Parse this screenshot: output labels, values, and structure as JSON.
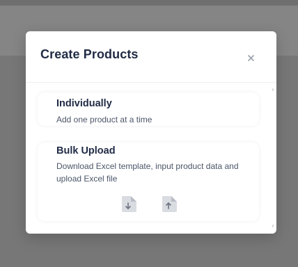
{
  "modal": {
    "title": "Create Products",
    "close_icon": "close-icon"
  },
  "options": [
    {
      "title": "Individually",
      "description": "Add one product at a time"
    },
    {
      "title": "Bulk Upload",
      "description": "Download Excel template, input product data and upload Excel file",
      "actions": [
        {
          "icon": "file-download-icon"
        },
        {
          "icon": "file-upload-icon"
        }
      ]
    }
  ],
  "colors": {
    "overlay": "#7a7a7a",
    "modal_bg": "#ffffff",
    "title_text": "#1f2a44",
    "desc_text": "#4a5568",
    "icon_fill": "#d9dce1",
    "icon_arrow": "#6b7280"
  }
}
